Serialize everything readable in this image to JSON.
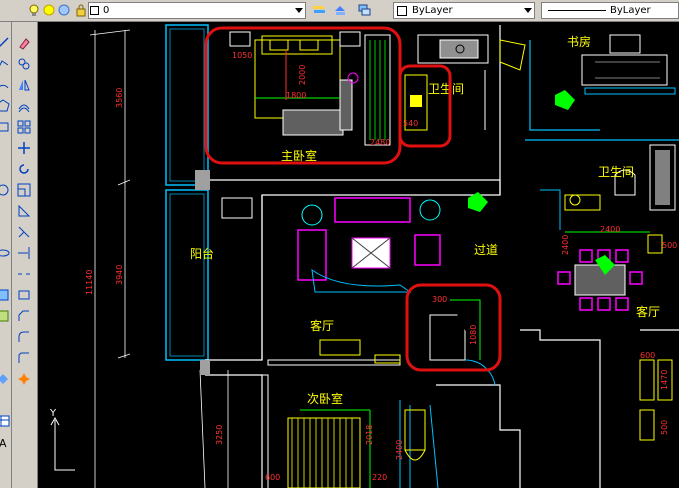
{
  "toolbar": {
    "layer_value": "0",
    "color_value": "ByLayer",
    "linetype_value": "ByLayer",
    "icons": [
      "lightbulb-icon",
      "sun-icon",
      "freeze-icon",
      "lock-icon",
      "color-swatch-icon",
      "layer-manager-icon",
      "layer-previous-icon",
      "layer-states-icon"
    ]
  },
  "left_tools": [
    "line-icon",
    "offset-icon",
    "mirror-icon",
    "move-icon",
    "array-icon",
    "rotate-icon",
    "scale-icon",
    "stretch-icon",
    "trim-icon",
    "extend-icon",
    "break-icon",
    "chamfer-icon",
    "fillet-icon",
    "explode-icon"
  ],
  "drawing": {
    "rooms": {
      "master_bedroom": "主卧室",
      "bathroom_1": "卫生间",
      "study": "书房",
      "bathroom_2": "卫生间",
      "balcony": "阳台",
      "hallway": "过道",
      "living_room_1": "客厅",
      "living_room_2": "客厅",
      "second_bedroom": "次卧室"
    },
    "dimensions": {
      "vertical_3560": "3560",
      "vertical_11140": "11140",
      "vertical_3940": "3940",
      "vertical_3250": "3250",
      "bed_1800": "1800",
      "bed_2000": "2000",
      "wardrobe_2480": "2480",
      "top_1050": "1050",
      "bath_540": "540",
      "door_300": "300",
      "door_1080": "1080",
      "dining_2400": "2400",
      "dining_side": "2400",
      "dining_500": "500",
      "right_600": "600",
      "right_1470": "1470",
      "right_500": "500",
      "bed2_2018": "2018",
      "bed2_2400": "2400",
      "bottom_600": "600",
      "bottom_220": "220"
    },
    "highlight_color": "#e01010",
    "wall_color": "#ffffff",
    "furniture_color": "#ffff00",
    "sofa_color": "#ff00ff",
    "plant_color": "#00ff00",
    "dimension_color": "#ff3030",
    "axis_label": "Y"
  }
}
